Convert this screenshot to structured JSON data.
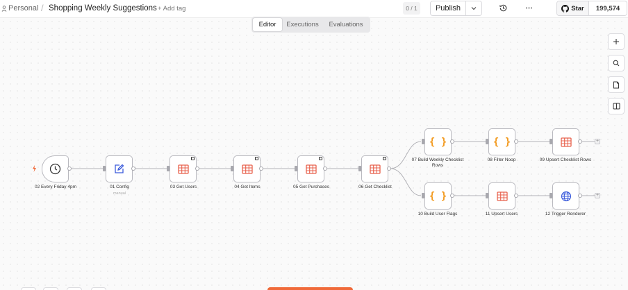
{
  "header": {
    "breadcrumb_project": "Personal",
    "breadcrumb_separator": "/",
    "workflow_title": "Shopping Weekly Suggestions",
    "add_tag_label": "+ Add tag",
    "version_counter": "0 / 1",
    "publish_label": "Publish",
    "github_star_label": "Star",
    "github_star_count": "199,574"
  },
  "tabs": [
    {
      "label": "Editor",
      "active": true
    },
    {
      "label": "Executions",
      "active": false
    },
    {
      "label": "Evaluations",
      "active": false
    }
  ],
  "side_toolbar": [
    "plus-icon",
    "search-icon",
    "sticky-note-icon",
    "panel-toggle-icon"
  ],
  "nodes": [
    {
      "id": "n02",
      "label": "02 Every Friday 4pm",
      "icon": "clock-icon",
      "type": "trigger"
    },
    {
      "id": "n01",
      "label": "01 Config",
      "sublabel": "manual",
      "icon": "edit-icon"
    },
    {
      "id": "n03",
      "label": "03 Get Users",
      "icon": "table-icon"
    },
    {
      "id": "n04",
      "label": "04 Get Items",
      "icon": "table-icon"
    },
    {
      "id": "n05",
      "label": "05 Get Purchases",
      "icon": "table-icon"
    },
    {
      "id": "n06",
      "label": "06 Get Checklist",
      "icon": "table-icon"
    },
    {
      "id": "n07",
      "label": "07 Build Weekly Checklist Rows",
      "icon": "code-braces-icon"
    },
    {
      "id": "n08",
      "label": "08 Filter Noop",
      "icon": "code-braces-icon"
    },
    {
      "id": "n09",
      "label": "09 Upsert Checklist Rows",
      "icon": "table-icon"
    },
    {
      "id": "n10",
      "label": "10 Build User Flags",
      "icon": "code-braces-icon"
    },
    {
      "id": "n11",
      "label": "11 Upsert Users",
      "icon": "table-icon"
    },
    {
      "id": "n12",
      "label": "12 Trigger Renderer",
      "icon": "globe-icon"
    }
  ],
  "colors": {
    "accent": "#f06a3a",
    "table_icon": "#e8604c",
    "code_icon": "#f29a1f",
    "globe_icon": "#3b5bdb",
    "edit_icon": "#3b5bdb",
    "trigger_bolt": "#f06a3a"
  }
}
